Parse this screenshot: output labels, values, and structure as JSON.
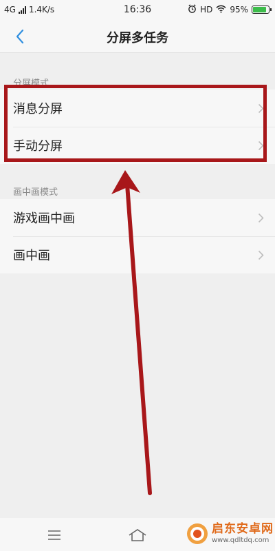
{
  "status_bar": {
    "network": "4G",
    "speed": "1.4K/s",
    "time": "16:36",
    "hd": "HD",
    "battery": "95%",
    "battery_level": 0.95
  },
  "header": {
    "title": "分屏多任务",
    "back_icon": "chevron-left-icon"
  },
  "sections": [
    {
      "header": "分屏模式",
      "items": [
        {
          "label": "消息分屏"
        },
        {
          "label": "手动分屏"
        }
      ]
    },
    {
      "header": "画中画模式",
      "items": [
        {
          "label": "游戏画中画"
        },
        {
          "label": "画中画"
        }
      ]
    }
  ],
  "bottom_nav": {
    "menu_icon": "menu-icon",
    "home_icon": "home-icon"
  },
  "watermark": {
    "text": "启东安卓网",
    "url": "www.qdltdq.com"
  },
  "colors": {
    "accent": "#2f8fe0",
    "highlight": "#a8171a",
    "battery": "#3cbc4a"
  }
}
